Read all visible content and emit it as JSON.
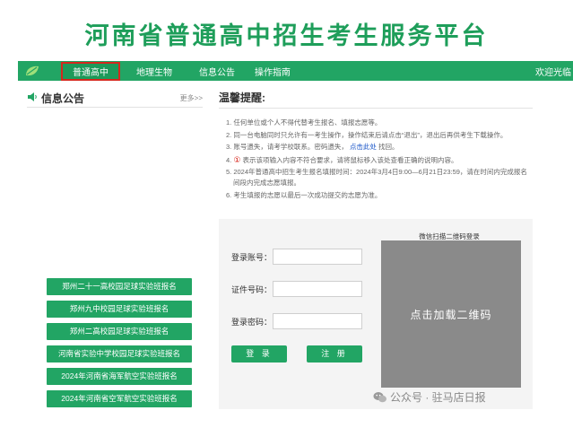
{
  "site_title": "河南省普通高中招生考生服务平台",
  "nav": {
    "items": [
      {
        "label": "普通高中",
        "active": true
      },
      {
        "label": "地理生物",
        "active": false
      },
      {
        "label": "信息公告",
        "active": false
      },
      {
        "label": "操作指南",
        "active": false
      }
    ],
    "right_text": "欢迎光临"
  },
  "notice": {
    "title": "信息公告",
    "more": "更多>>"
  },
  "side_buttons": [
    "郑州二十一高校园足球实验班报名",
    "郑州九中校园足球实验班报名",
    "郑州二高校园足球实验班报名",
    "河南省实验中学校园足球实验班报名",
    "2024年河南省海军航空实验班报名",
    "2024年河南省空军航空实验班报名"
  ],
  "tips": {
    "title": "温馨提醒:",
    "items": [
      {
        "pre": "1. 任何单位或个人不得代替考生报名、填报志愿等。"
      },
      {
        "pre": "2. 同一台电脑同时只允许有一考生操作，操作结束后请点击“退出”，退出后再供考生下载操作。"
      },
      {
        "pre": "3. 账号遗失，请考学校联系。密码遗失，",
        "link": "点击此处",
        "post": "找回。"
      },
      {
        "warn": "①",
        "pre": "4.",
        "post": "表示该项输入内容不符合要求，请将鼠标移入该处查看正确的说明内容。"
      },
      {
        "pre": "5. 2024年普通高中招生考生报名填报时间：2024年3月4日9:00—6月21日23:59，请在时间内完成报名",
        "post2": "间段内完成志愿填报。"
      },
      {
        "pre": "6. 考生填报的志愿以最后一次成功提交的志愿为准。"
      }
    ]
  },
  "login": {
    "account_label": "登录账号：",
    "cert_label": "证件号码：",
    "password_label": "登录密码：",
    "account_value": "",
    "cert_value": "",
    "password_value": "",
    "login_button": "登 录",
    "register_button": "注 册"
  },
  "qr": {
    "caption": "微信扫描二维码登录",
    "placeholder": "点击加载二维码"
  },
  "watermark": "公众号 · 驻马店日报",
  "colors": {
    "brand_green": "#22a564",
    "title_green": "#1e9e5a",
    "active_border": "#d6271d",
    "qr_gray": "#8a8a8a"
  }
}
